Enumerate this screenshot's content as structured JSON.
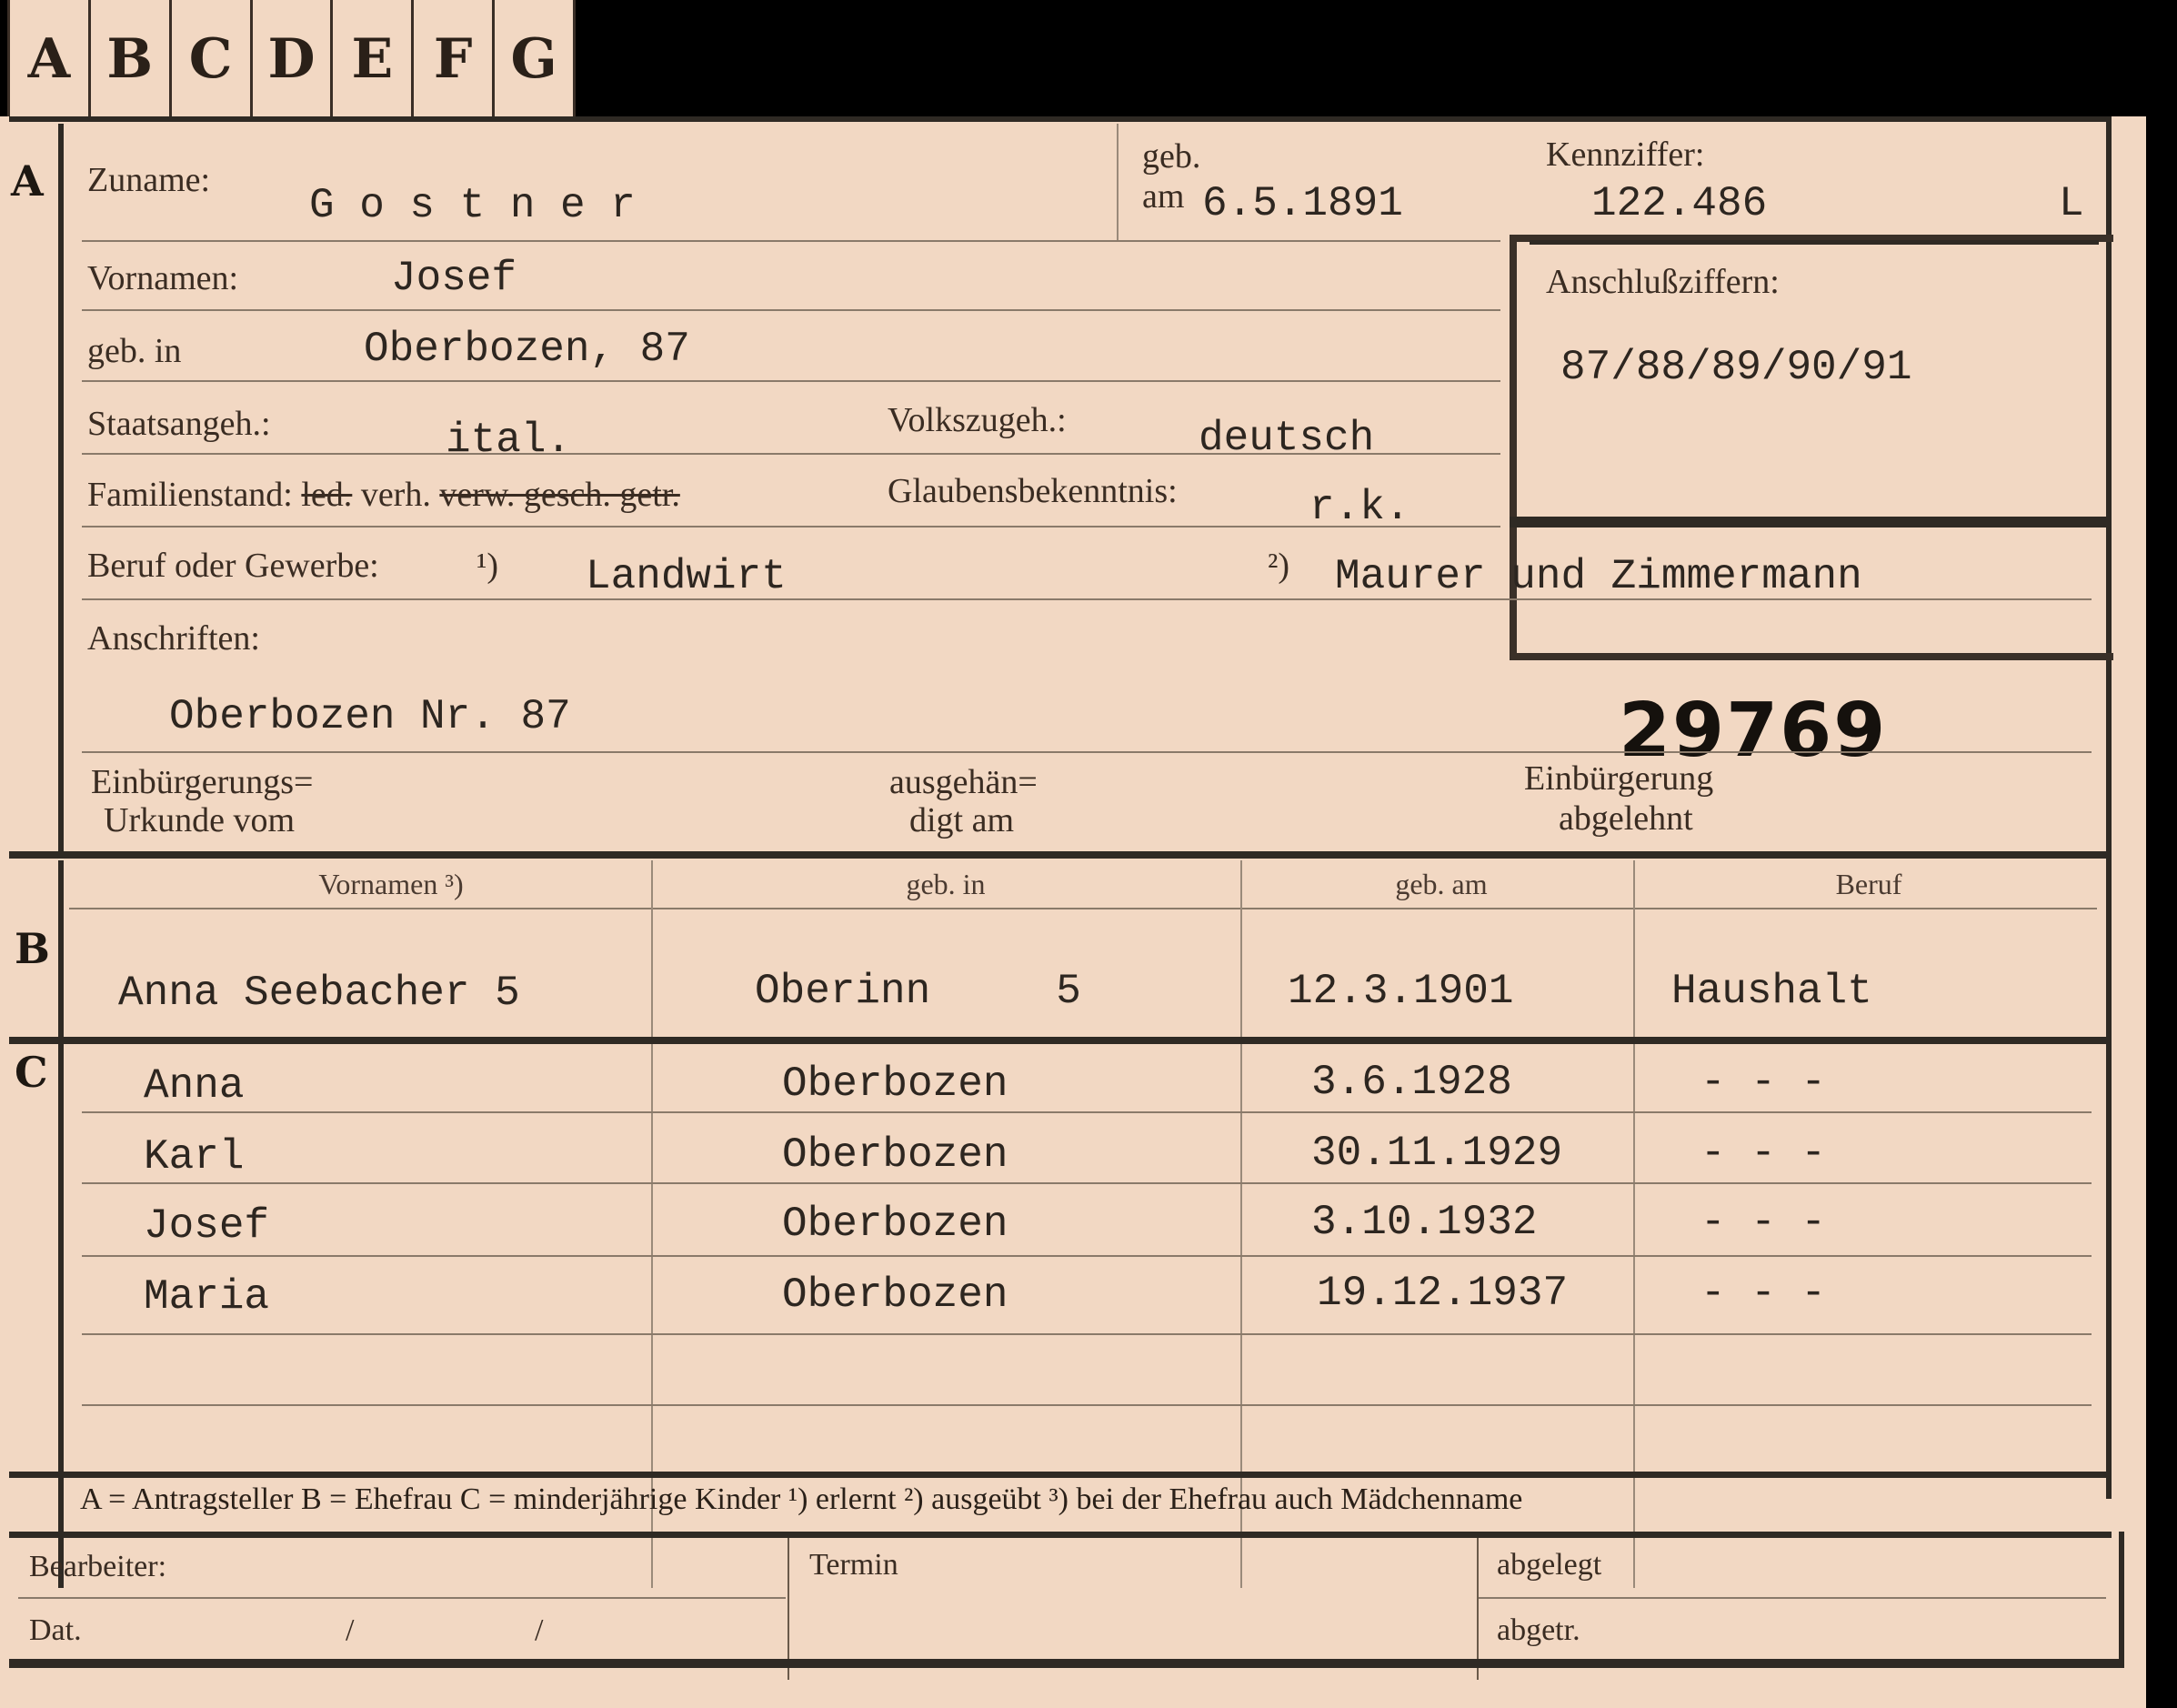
{
  "tabs": [
    "A",
    "B",
    "C",
    "D",
    "E",
    "F",
    "G"
  ],
  "section_letters": {
    "a": "A",
    "b": "B",
    "c": "C"
  },
  "a": {
    "zuname_label": "Zuname:",
    "zuname": "G o s t n e r",
    "geb_label": "geb.",
    "am_label": "am",
    "geb_am": "6.5.1891",
    "kennziffer_label": "Kennziffer:",
    "kennziffer": "122.486",
    "kennziffer_suffix": "L",
    "anschluss_label": "Anschlußziffern:",
    "anschluss": "87/88/89/90/91",
    "vornamen_label": "Vornamen:",
    "vornamen": "Josef",
    "gebin_label": "geb. in",
    "gebin": "Oberbozen, 87",
    "staats_label": "Staatsangeh.:",
    "staats": "ital.",
    "volks_label": "Volkszugeh.:",
    "volks": "deutsch",
    "familien_label": "Familienstand:",
    "familien_led": "led.",
    "familien_verh": "verh.",
    "familien_struck": "verw. gesch. getr.",
    "glauben_label": "Glaubensbekenntnis:",
    "glauben": "r.k.",
    "beruf_label": "Beruf oder Gewerbe:",
    "beruf_note1": "¹)",
    "beruf1": "Landwirt",
    "beruf_note2": "²)",
    "beruf2": "Maurer und Zimmermann",
    "anschriften_label": "Anschriften:",
    "anschrift": "Oberbozen Nr. 87",
    "stamp": "29769",
    "urkunde_label_1": "Einbürgerungs=",
    "urkunde_label_2": "Urkunde vom",
    "ausgeh_label_1": "ausgehän=",
    "ausgeh_label_2": "digt am",
    "abgelehnt_label_1": "Einbürgerung",
    "abgelehnt_label_2": "abgelehnt"
  },
  "b": {
    "headers": [
      "Vornamen ³)",
      "geb. in",
      "geb. am",
      "Beruf"
    ],
    "row": {
      "name": "Anna Seebacher 5",
      "place": "Oberinn     5",
      "date": "12.3.1901",
      "job": "Haushalt"
    }
  },
  "c": {
    "rows": [
      {
        "name": "Anna",
        "place": "Oberbozen",
        "date": "3.6.1928",
        "job": "- - -"
      },
      {
        "name": "Karl",
        "place": "Oberbozen",
        "date": "30.11.1929",
        "job": "- - -"
      },
      {
        "name": "Josef",
        "place": "Oberbozen",
        "date": "3.10.1932",
        "job": "- - -"
      },
      {
        "name": "Maria",
        "place": "Oberbozen",
        "date": "19.12.1937",
        "job": "- - -"
      }
    ]
  },
  "footer_note": "A = Antragsteller   B = Ehefrau   C = minderjährige Kinder   ¹) erlernt   ²) ausgeübt   ³) bei der Ehefrau auch Mädchenname",
  "bottom": {
    "bearbeiter_label": "Bearbeiter:",
    "dat_label": "Dat.",
    "slash1": "/",
    "slash2": "/",
    "termin_label": "Termin",
    "abgelegt_label": "abgelegt",
    "abgetr_label": "abgetr."
  },
  "colors": {
    "paper": "#f2d8c3",
    "ink": "#2d2620",
    "rule": "#2f2a24",
    "background": "#000000"
  }
}
